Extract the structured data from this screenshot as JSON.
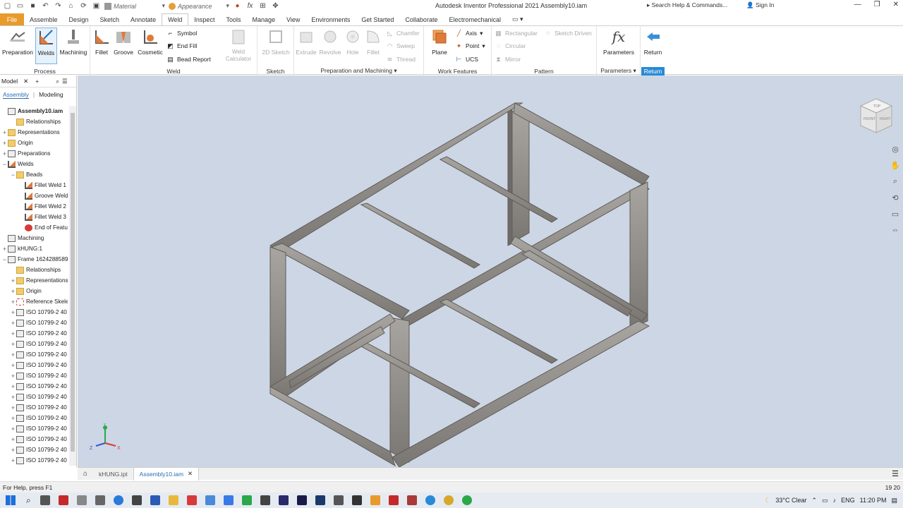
{
  "window": {
    "title": "Autodesk Inventor Professional 2021    Assembly10.iam",
    "help_placeholder": "Search Help & Commands...",
    "sign_in": "Sign In"
  },
  "qat": {
    "material_label": "Material",
    "appearance_label": "Appearance"
  },
  "tabs": [
    "File",
    "Assemble",
    "Design",
    "Sketch",
    "Annotate",
    "Weld",
    "Inspect",
    "Tools",
    "Manage",
    "View",
    "Environments",
    "Get Started",
    "Collaborate",
    "Electromechanical"
  ],
  "active_tab": "Weld",
  "ribbon": {
    "process": {
      "label": "Process",
      "preparation": "Preparation",
      "welds": "Welds",
      "machining": "Machining"
    },
    "weld": {
      "label": "Weld",
      "fillet": "Fillet",
      "groove": "Groove",
      "cosmetic": "Cosmetic",
      "symbol": "Symbol",
      "end_fill": "End Fill",
      "bead_report": "Bead Report",
      "weld_calculator_1": "Weld",
      "weld_calculator_2": "Calculator"
    },
    "sketch": {
      "label": "Sketch",
      "sketch2d": "2D Sketch"
    },
    "prep": {
      "label": "Preparation and Machining",
      "extrude": "Extrude",
      "revolve": "Revolve",
      "hole": "Hole",
      "fillet": "Fillet",
      "chamfer": "Chamfer",
      "sweep": "Sweep",
      "thread": "Thread"
    },
    "work": {
      "label": "Work Features",
      "plane": "Plane",
      "axis": "Axis",
      "point": "Point",
      "ucs": "UCS"
    },
    "pattern": {
      "label": "Pattern",
      "rectangular": "Rectangular",
      "circular": "Circular",
      "mirror": "Mirror",
      "sketch_driven": "Sketch Driven"
    },
    "parameters": {
      "label": "Parameters",
      "parameters": "Parameters",
      "return": "Return",
      "return_label": "Return"
    }
  },
  "browser": {
    "header": "Model",
    "tab_assembly": "Assembly",
    "tab_modeling": "Modeling",
    "tree": [
      {
        "label": "Assembly10.iam",
        "icon": "assembly-icon",
        "indent": 0,
        "exp": "",
        "bold": true
      },
      {
        "label": "Relationships",
        "icon": "folder-icon",
        "indent": 1,
        "exp": ""
      },
      {
        "label": "Representations",
        "icon": "folder-icon",
        "indent": 0,
        "exp": "+"
      },
      {
        "label": "Origin",
        "icon": "folder-icon",
        "indent": 0,
        "exp": "+"
      },
      {
        "label": "Preparations",
        "icon": "preparation-icon",
        "indent": 0,
        "exp": "+"
      },
      {
        "label": "Welds",
        "icon": "weld-icon",
        "indent": 0,
        "exp": "−"
      },
      {
        "label": "Beads",
        "icon": "folder-icon",
        "indent": 1,
        "exp": "−"
      },
      {
        "label": "Fillet Weld 1",
        "icon": "weld-icon",
        "indent": 2,
        "exp": ""
      },
      {
        "label": "Groove Weld",
        "icon": "weld-icon",
        "indent": 2,
        "exp": ""
      },
      {
        "label": "Fillet Weld 2",
        "icon": "weld-icon",
        "indent": 2,
        "exp": ""
      },
      {
        "label": "Fillet Weld 3",
        "icon": "weld-icon",
        "indent": 2,
        "exp": ""
      },
      {
        "label": "End of Featu",
        "icon": "error-icon",
        "indent": 2,
        "exp": ""
      },
      {
        "label": "Machining",
        "icon": "machining-icon",
        "indent": 0,
        "exp": ""
      },
      {
        "label": "kHUNG:1",
        "icon": "part-icon",
        "indent": 0,
        "exp": "+"
      },
      {
        "label": "Frame 1624288589",
        "icon": "assembly-icon",
        "indent": 0,
        "exp": "−"
      },
      {
        "label": "Relationships",
        "icon": "folder-icon",
        "indent": 1,
        "exp": ""
      },
      {
        "label": "Representations",
        "icon": "folder-icon",
        "indent": 1,
        "exp": "+"
      },
      {
        "label": "Origin",
        "icon": "folder-icon",
        "indent": 1,
        "exp": "+"
      },
      {
        "label": "Reference Skele",
        "icon": "skeleton-icon",
        "indent": 1,
        "exp": "+"
      },
      {
        "label": "ISO 10799-2 40",
        "icon": "profile-icon",
        "indent": 1,
        "exp": "+"
      },
      {
        "label": "ISO 10799-2 40",
        "icon": "profile-icon",
        "indent": 1,
        "exp": "+"
      },
      {
        "label": "ISO 10799-2 40",
        "icon": "profile-icon",
        "indent": 1,
        "exp": "+"
      },
      {
        "label": "ISO 10799-2 40",
        "icon": "profile-icon",
        "indent": 1,
        "exp": "+"
      },
      {
        "label": "ISO 10799-2 40",
        "icon": "profile-icon",
        "indent": 1,
        "exp": "+"
      },
      {
        "label": "ISO 10799-2 40",
        "icon": "profile-icon",
        "indent": 1,
        "exp": "+"
      },
      {
        "label": "ISO 10799-2 40",
        "icon": "profile-icon",
        "indent": 1,
        "exp": "+"
      },
      {
        "label": "ISO 10799-2 40",
        "icon": "profile-icon",
        "indent": 1,
        "exp": "+"
      },
      {
        "label": "ISO 10799-2 40",
        "icon": "profile-icon",
        "indent": 1,
        "exp": "+"
      },
      {
        "label": "ISO 10799-2 40",
        "icon": "profile-icon",
        "indent": 1,
        "exp": "+"
      },
      {
        "label": "ISO 10799-2 40",
        "icon": "profile-icon",
        "indent": 1,
        "exp": "+"
      },
      {
        "label": "ISO 10799-2 40",
        "icon": "profile-icon",
        "indent": 1,
        "exp": "+"
      },
      {
        "label": "ISO 10799-2 40",
        "icon": "profile-icon",
        "indent": 1,
        "exp": "+"
      },
      {
        "label": "ISO 10799-2 40",
        "icon": "profile-icon",
        "indent": 1,
        "exp": "+"
      },
      {
        "label": "ISO 10799-2 40",
        "icon": "profile-icon",
        "indent": 1,
        "exp": "+"
      }
    ]
  },
  "viewcube": {
    "top": "TOP",
    "front": "FRONT",
    "right": "RIGHT"
  },
  "axes": {
    "y": "Y",
    "x": "X",
    "z": "Z"
  },
  "doc_tabs": [
    {
      "label": "kHUNG.ipt",
      "active": false
    },
    {
      "label": "Assembly10.iam",
      "active": true
    }
  ],
  "status": {
    "help": "For Help, press F1",
    "right": "19  20"
  },
  "taskbar": {
    "weather": "33°C  Clear",
    "lang": "ENG",
    "time": "11:20 PM"
  },
  "colors": {
    "file_tab": "#e89a2b",
    "accent": "#2a6db5",
    "viewport": "#cdd6e4",
    "frame": "#8a8783"
  }
}
